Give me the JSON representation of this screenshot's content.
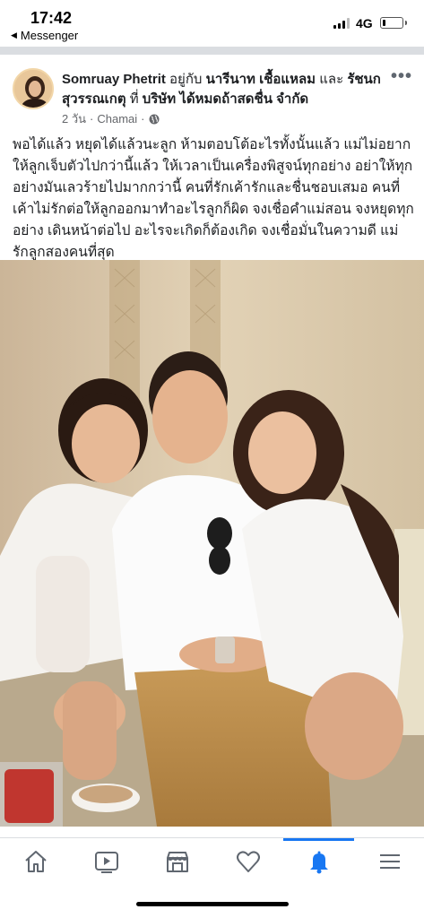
{
  "status_bar": {
    "time": "17:42",
    "back_app": "Messenger",
    "network": "4G",
    "battery_level": 0.15
  },
  "post": {
    "author": "Somruay Phetrit",
    "with_text": "อยู่กับ",
    "tagged_1": "นารีนาท เชื้อแหลม",
    "and_text": "และ",
    "tagged_2": "รัชนก สุวรรณเกตุ",
    "at_text": "ที่",
    "place": "บริษัท ได้หมดถ้าสดชื่น จำกัด",
    "time_ago": "2 วัน",
    "separator": "·",
    "location": "Chamai",
    "privacy_icon": "globe-icon",
    "more_label": "•••",
    "body": "พอได้แล้ว หยุดได้แล้วนะลูก ห้ามตอบโต้อะไรทั้งนั้นแล้ว แม่ไม่อยากให้ลูกเจ็บตัวไปกว่านี้แล้ว ให้เวลาเป็นเครื่องพิสูจน์ทุกอย่าง อย่าให้ทุกอย่างมันเลวร้ายไปมากกว่านี้ คนที่รักเค้ารักและชื่นชอบเสมอ คนที่เค้าไม่รักต่อให้ลูกออกมาทำอะไรลูกก็ผิด จงเชื่อคำแม่สอน จงหยุดทุกอย่าง เดินหน้าต่อไป อะไรจะเกิดก็ต้องเกิด จงเชื่อมั่นในความดี แม่รักลูกสองคนที่สุด"
  },
  "bottom_nav": {
    "items": [
      {
        "icon": "home-icon"
      },
      {
        "icon": "video-icon"
      },
      {
        "icon": "marketplace-icon"
      },
      {
        "icon": "heart-icon"
      },
      {
        "icon": "notifications-bell-icon",
        "active": true
      },
      {
        "icon": "menu-icon"
      }
    ],
    "accent_color": "#1877f2"
  }
}
